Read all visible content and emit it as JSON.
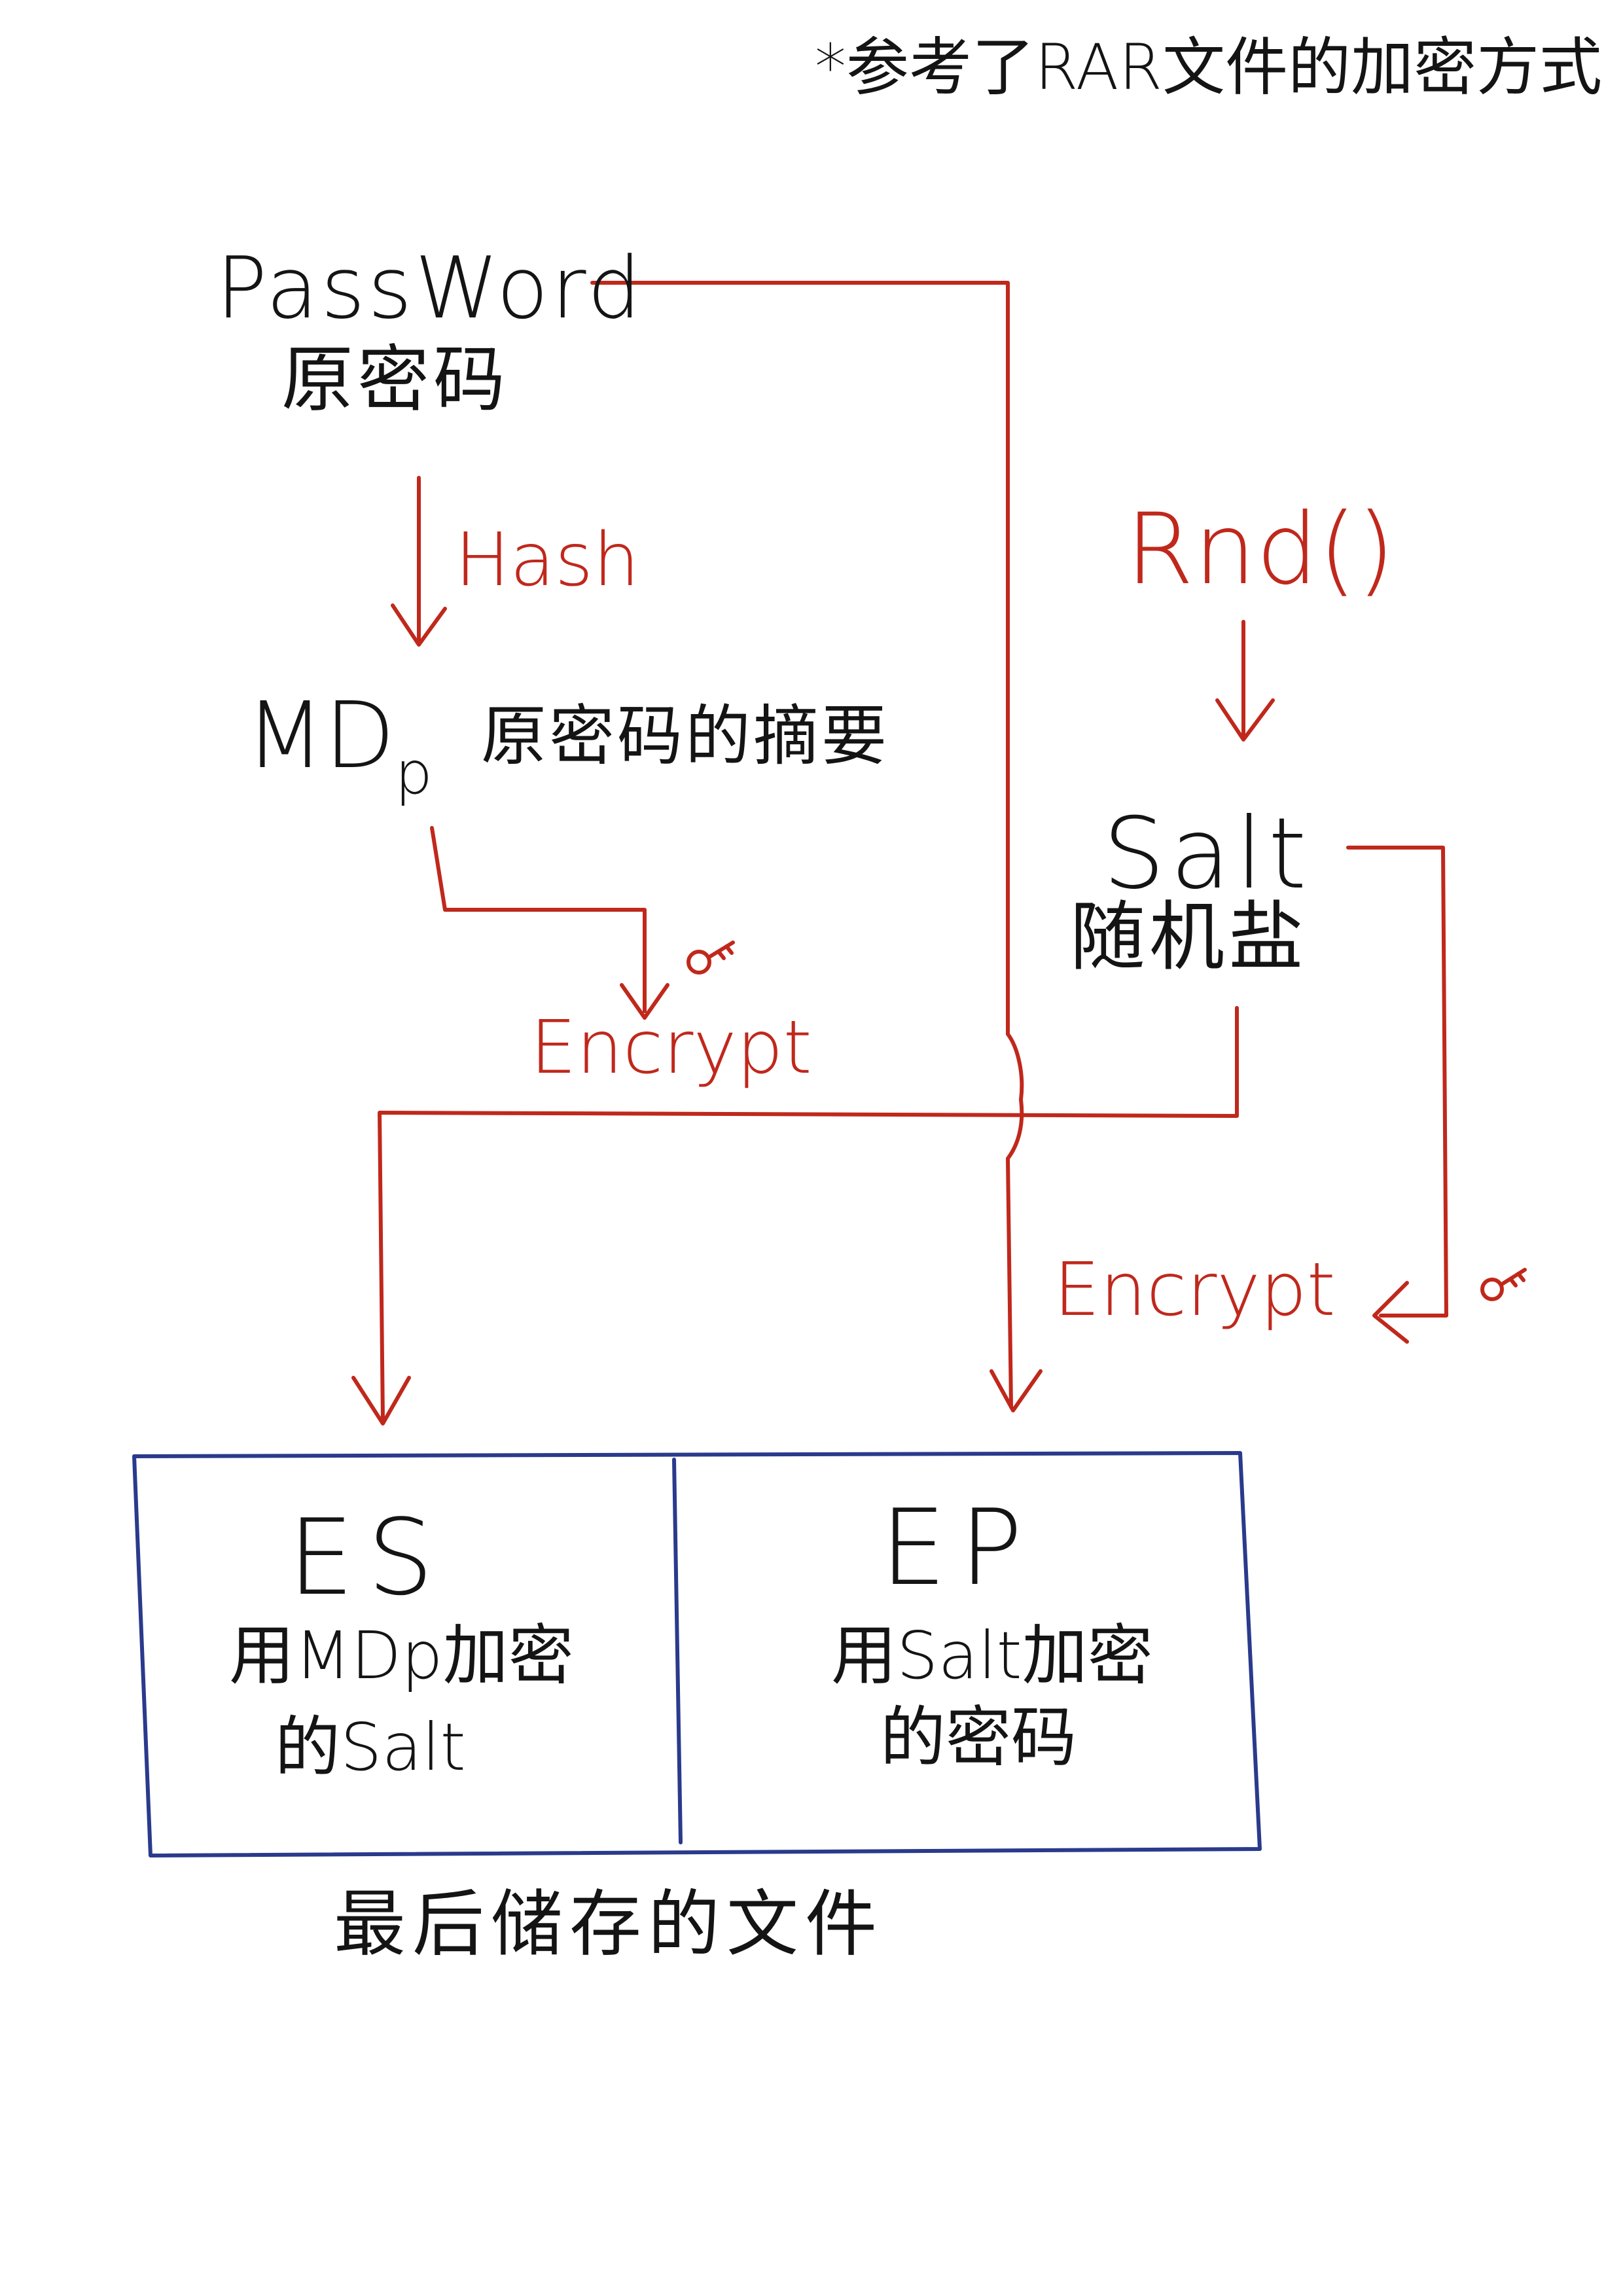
{
  "note": "*参考了RAR文件的加密方式",
  "password": {
    "label_en": "PassWord",
    "label_zh": "原密码"
  },
  "hash_label": "Hash",
  "mdp": {
    "label_main": "MD",
    "label_sub": "p",
    "desc": "原密码的摘要"
  },
  "rnd_label": "Rnd()",
  "salt": {
    "label_en": "Salt",
    "label_zh": "随机盐"
  },
  "encrypt_left": "Encrypt",
  "encrypt_right": "Encrypt",
  "file_box": {
    "es": {
      "title": "ES",
      "line1": "用MDp加密",
      "line2": "的Salt"
    },
    "ep": {
      "title": "EP",
      "line1": "用Salt加密",
      "line2": "的密码"
    }
  },
  "final_caption": "最后储存的文件",
  "colors": {
    "ink": "#141414",
    "arrow": "#c0281c",
    "box": "#2a3a8c"
  }
}
